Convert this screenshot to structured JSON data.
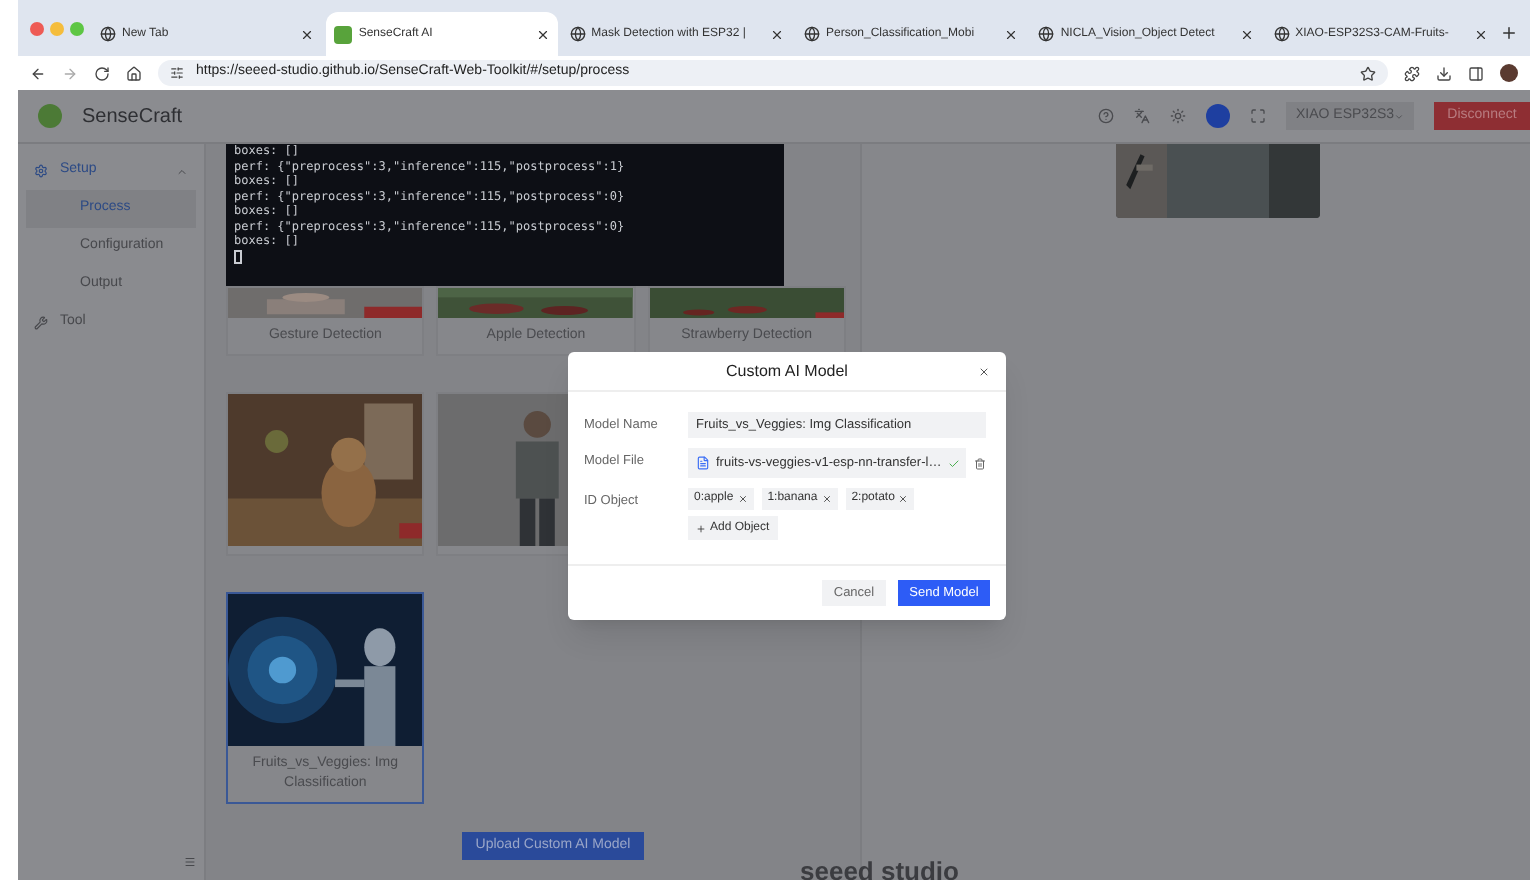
{
  "browser": {
    "tabs": [
      {
        "title": "New Tab",
        "selected": false
      },
      {
        "title": "SenseCraft AI",
        "selected": true
      },
      {
        "title": "Mask Detection with ESP32 |",
        "selected": false
      },
      {
        "title": "Person_Classification_Mobi",
        "selected": false
      },
      {
        "title": "NICLA_Vision_Object Detect",
        "selected": false
      },
      {
        "title": "XIAO-ESP32S3-CAM-Fruits-",
        "selected": false
      }
    ],
    "url": "https://seeed-studio.github.io/SenseCraft-Web-Toolkit/#/setup/process"
  },
  "app": {
    "brand": "SenseCraft",
    "device": "XIAO ESP32S3",
    "disconnect": "Disconnect",
    "sidebar": {
      "items": [
        {
          "label": "Setup",
          "expanded": true,
          "children": [
            {
              "label": "Process",
              "selected": true
            },
            {
              "label": "Configuration",
              "selected": false
            },
            {
              "label": "Output",
              "selected": false
            }
          ]
        },
        {
          "label": "Tool"
        }
      ]
    },
    "console": {
      "lines": [
        "boxes: []",
        "perf: {\"preprocess\":3,\"inference\":115,\"postprocess\":1}",
        "boxes: []",
        "perf: {\"preprocess\":3,\"inference\":115,\"postprocess\":0}",
        "boxes: []",
        "perf: {\"preprocess\":3,\"inference\":115,\"postprocess\":0}",
        "boxes: []"
      ]
    },
    "models": [
      {
        "label": "Gesture Detection",
        "selected": false
      },
      {
        "label": "Apple Detection",
        "selected": false
      },
      {
        "label": "Strawberry Detection",
        "selected": false
      },
      {
        "selected": false
      },
      {
        "selected": false
      },
      {
        "label": "Fruits_vs_Veggies: Img Classification",
        "selected": true
      }
    ],
    "upload_button": "Upload Custom AI Model",
    "footer": "seeed studio"
  },
  "dialog": {
    "title": "Custom AI Model",
    "fields": [
      {
        "kind": "text",
        "label": "Model Name",
        "value": "Fruits_vs_Veggies: Img Classification"
      },
      {
        "kind": "file",
        "label": "Model File",
        "value": "fruits-vs-veggies-v1-esp-nn-transfer-l…"
      },
      {
        "kind": "tags",
        "label": "ID Object",
        "tags": [
          "0:apple",
          "1:banana",
          "2:potato"
        ],
        "add": "Add Object"
      }
    ],
    "cancel": "Cancel",
    "submit": "Send Model"
  }
}
